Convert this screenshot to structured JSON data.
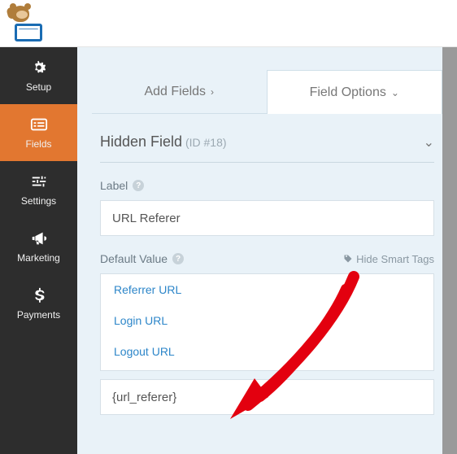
{
  "sidebar": {
    "items": [
      {
        "label": "Setup"
      },
      {
        "label": "Fields"
      },
      {
        "label": "Settings"
      },
      {
        "label": "Marketing"
      },
      {
        "label": "Payments"
      }
    ]
  },
  "tabs": {
    "add": "Add Fields",
    "options": "Field Options"
  },
  "section": {
    "title": "Hidden Field",
    "id": "(ID #18)"
  },
  "fields": {
    "label_caption": "Label",
    "label_value": "URL Referer",
    "default_caption": "Default Value",
    "hide_tags": "Hide Smart Tags",
    "suggestions": [
      "Referrer URL",
      "Login URL",
      "Logout URL"
    ],
    "default_value": "{url_referer}"
  }
}
